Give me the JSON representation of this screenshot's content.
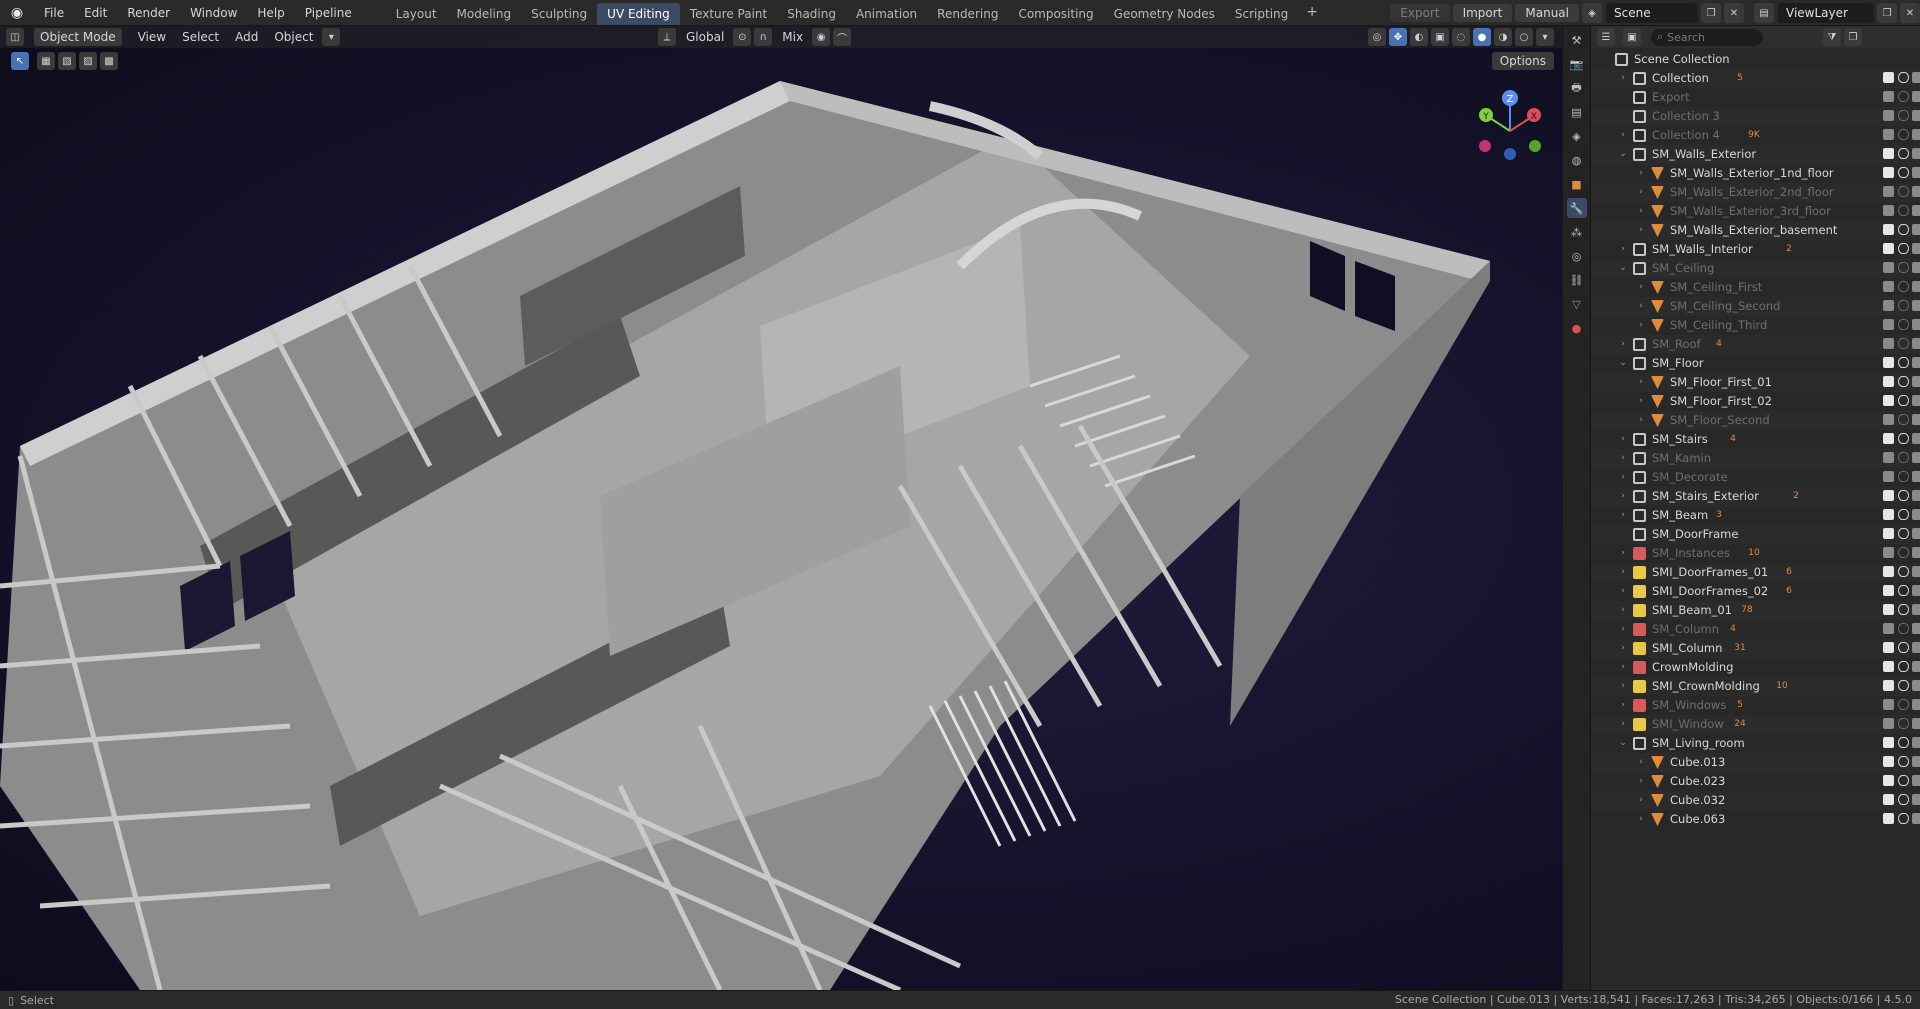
{
  "app": {
    "menu": [
      "File",
      "Edit",
      "Render",
      "Window",
      "Help",
      "Pipeline"
    ],
    "workspaces": [
      "Layout",
      "Modeling",
      "Sculpting",
      "UV Editing",
      "Texture Paint",
      "Shading",
      "Animation",
      "Rendering",
      "Compositing",
      "Geometry Nodes",
      "Scripting"
    ],
    "active_workspace": "UV Editing",
    "add_workspace": "+",
    "top_right": {
      "export": "Export",
      "import": "Import",
      "manual": "Manual",
      "scene": "Scene",
      "view_layer": "ViewLayer"
    }
  },
  "viewport": {
    "mode": "Object Mode",
    "menus": [
      "View",
      "Select",
      "Add",
      "Object"
    ],
    "transform_orientation": "Global",
    "snap_mode": "Mix",
    "options": "Options",
    "gizmo_axes": [
      "Z",
      "Y",
      "X"
    ]
  },
  "outliner": {
    "search_placeholder": "Search",
    "rows": [
      {
        "label": "Scene Collection",
        "indent": 0,
        "icon": "coll-w",
        "arrow": "",
        "dim": false
      },
      {
        "label": "Collection",
        "indent": 1,
        "icon": "coll-w",
        "arrow": "›",
        "dim": false,
        "tag": "5"
      },
      {
        "label": "Export",
        "indent": 1,
        "icon": "coll-w",
        "arrow": "",
        "dim": true
      },
      {
        "label": "Collection 3",
        "indent": 1,
        "icon": "coll-w",
        "arrow": "",
        "dim": true
      },
      {
        "label": "Collection 4",
        "indent": 1,
        "icon": "coll-w",
        "arrow": "›",
        "dim": true,
        "tag": "9K"
      },
      {
        "label": "SM_Walls_Exterior",
        "indent": 1,
        "icon": "coll-w",
        "arrow": "⌄",
        "dim": false
      },
      {
        "label": "SM_Walls_Exterior_1nd_floor",
        "indent": 2,
        "icon": "obj",
        "arrow": "›",
        "dim": false
      },
      {
        "label": "SM_Walls_Exterior_2nd_floor",
        "indent": 2,
        "icon": "obj",
        "arrow": "›",
        "dim": true
      },
      {
        "label": "SM_Walls_Exterior_3rd_floor",
        "indent": 2,
        "icon": "obj",
        "arrow": "›",
        "dim": true
      },
      {
        "label": "SM_Walls_Exterior_basement",
        "indent": 2,
        "icon": "obj",
        "arrow": "›",
        "dim": false
      },
      {
        "label": "SM_Walls_Interior",
        "indent": 1,
        "icon": "coll-w",
        "arrow": "›",
        "dim": false,
        "tag": "2"
      },
      {
        "label": "SM_Ceiling",
        "indent": 1,
        "icon": "coll-w",
        "arrow": "⌄",
        "dim": true
      },
      {
        "label": "SM_Ceiling_First",
        "indent": 2,
        "icon": "obj",
        "arrow": "›",
        "dim": true
      },
      {
        "label": "SM_Ceiling_Second",
        "indent": 2,
        "icon": "obj",
        "arrow": "›",
        "dim": true
      },
      {
        "label": "SM_Ceiling_Third",
        "indent": 2,
        "icon": "obj",
        "arrow": "›",
        "dim": true
      },
      {
        "label": "SM_Roof",
        "indent": 1,
        "icon": "coll-w",
        "arrow": "›",
        "dim": true,
        "tag": "4"
      },
      {
        "label": "SM_Floor",
        "indent": 1,
        "icon": "coll-w",
        "arrow": "⌄",
        "dim": false
      },
      {
        "label": "SM_Floor_First_01",
        "indent": 2,
        "icon": "obj",
        "arrow": "›",
        "dim": false
      },
      {
        "label": "SM_Floor_First_02",
        "indent": 2,
        "icon": "obj",
        "arrow": "›",
        "dim": false
      },
      {
        "label": "SM_Floor_Second",
        "indent": 2,
        "icon": "obj",
        "arrow": "›",
        "dim": true
      },
      {
        "label": "SM_Stairs",
        "indent": 1,
        "icon": "coll-w",
        "arrow": "›",
        "dim": false,
        "tag": "4"
      },
      {
        "label": "SM_Kamin",
        "indent": 1,
        "icon": "coll-w",
        "arrow": "›",
        "dim": true
      },
      {
        "label": "SM_Decorate",
        "indent": 1,
        "icon": "coll-w",
        "arrow": "›",
        "dim": true
      },
      {
        "label": "SM_Stairs_Exterior",
        "indent": 1,
        "icon": "coll-w",
        "arrow": "›",
        "dim": false,
        "tag": "2"
      },
      {
        "label": "SM_Beam",
        "indent": 1,
        "icon": "coll-w",
        "arrow": "›",
        "dim": false,
        "tag": "3"
      },
      {
        "label": "SM_DoorFrame",
        "indent": 1,
        "icon": "coll-w",
        "arrow": "",
        "dim": false
      },
      {
        "label": "SM_Instances",
        "indent": 1,
        "icon": "coll-r",
        "arrow": "›",
        "dim": true,
        "tag": "10"
      },
      {
        "label": "SMI_DoorFrames_01",
        "indent": 1,
        "icon": "coll-y",
        "arrow": "›",
        "dim": false,
        "tag": "6"
      },
      {
        "label": "SMI_DoorFrames_02",
        "indent": 1,
        "icon": "coll-y",
        "arrow": "›",
        "dim": false,
        "tag": "6"
      },
      {
        "label": "SMI_Beam_01",
        "indent": 1,
        "icon": "coll-y",
        "arrow": "›",
        "dim": false,
        "tag": "78"
      },
      {
        "label": "SM_Column",
        "indent": 1,
        "icon": "coll-r",
        "arrow": "›",
        "dim": true,
        "tag": "4"
      },
      {
        "label": "SMI_Column",
        "indent": 1,
        "icon": "coll-y",
        "arrow": "›",
        "dim": false,
        "tag": "31"
      },
      {
        "label": "CrownMolding",
        "indent": 1,
        "icon": "coll-r",
        "arrow": "›",
        "dim": false
      },
      {
        "label": "SMI_CrownMolding",
        "indent": 1,
        "icon": "coll-y",
        "arrow": "›",
        "dim": false,
        "tag": "10"
      },
      {
        "label": "SM_Windows",
        "indent": 1,
        "icon": "coll-r",
        "arrow": "›",
        "dim": true,
        "tag": "5"
      },
      {
        "label": "SMI_Window",
        "indent": 1,
        "icon": "coll-y",
        "arrow": "›",
        "dim": true,
        "tag": "24"
      },
      {
        "label": "SM_Living_room",
        "indent": 1,
        "icon": "coll-w",
        "arrow": "⌄",
        "dim": false
      },
      {
        "label": "Cube.013",
        "indent": 2,
        "icon": "obj",
        "arrow": "›",
        "dim": false
      },
      {
        "label": "Cube.023",
        "indent": 2,
        "icon": "obj",
        "arrow": "›",
        "dim": false
      },
      {
        "label": "Cube.032",
        "indent": 2,
        "icon": "obj",
        "arrow": "›",
        "dim": false
      },
      {
        "label": "Cube.063",
        "indent": 2,
        "icon": "obj",
        "arrow": "›",
        "dim": false
      }
    ]
  },
  "status": {
    "left": "Select",
    "right": "Scene Collection | Cube.013 | Verts:18,541 | Faces:17,263 | Tris:34,265 | Objects:0/166 | 4.5.0"
  },
  "colors": {
    "accent": "#4772b3",
    "active_tab": "#3d4a63",
    "object_icon": "#e08b3c",
    "collection_yellow": "#e8c84a",
    "collection_red": "#d95a5a"
  }
}
